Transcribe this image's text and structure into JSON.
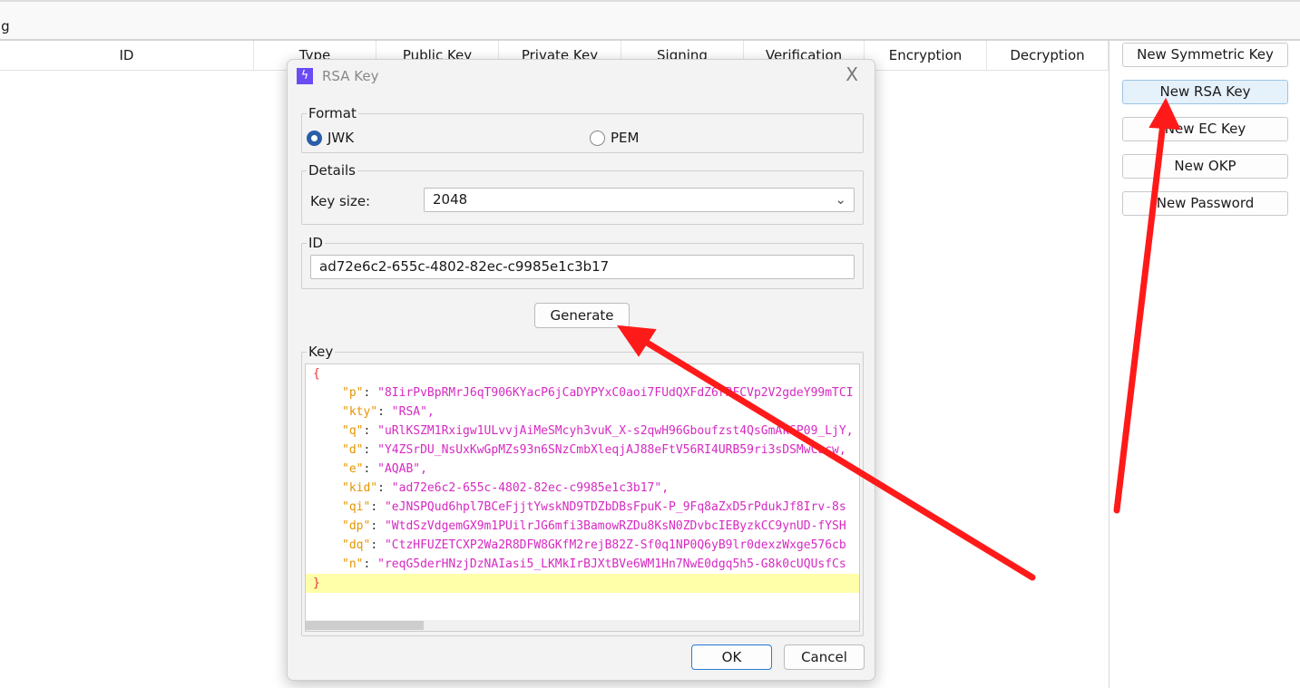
{
  "topbar": {
    "text": "ig"
  },
  "table": {
    "columns": [
      "ID",
      "Type",
      "Public Key",
      "Private Key",
      "Signing",
      "Verification",
      "Encryption",
      "Decryption"
    ]
  },
  "side_buttons": [
    "New Symmetric Key",
    "New RSA Key",
    "New EC Key",
    "New OKP",
    "New Password"
  ],
  "dialog": {
    "title": "RSA Key",
    "logo_icon": "lightning-icon",
    "close": "X",
    "format": {
      "label": "Format",
      "options": [
        "JWK",
        "PEM"
      ],
      "selected": "JWK"
    },
    "details": {
      "label": "Details",
      "key_size_label": "Key size:",
      "key_size": "2048"
    },
    "id": {
      "label": "ID",
      "value": "ad72e6c2-655c-4802-82ec-c9985e1c3b17"
    },
    "generate": "Generate",
    "key": {
      "label": "Key",
      "open": "{",
      "close": "}",
      "entries": [
        {
          "k": "\"p\"",
          "v": "\"8IirPvBpRMrJ6qT906KYacP6jCaDYPYxC0aoi7FUdQXFdZ6rRFCVp2V2gdeY99mTCI"
        },
        {
          "k": "\"kty\"",
          "v": "\"RSA\","
        },
        {
          "k": "\"q\"",
          "v": "\"uRlKSZM1Rxigw1ULvvjAiMeSMcyh3vuK_X-s2qwH96Gboufzst4QsGmAkSP09_LjY,"
        },
        {
          "k": "\"d\"",
          "v": "\"Y4ZSrDU_NsUxKwGpMZs93n6SNzCmbXleqjAJ88eFtV56RI4URB59ri3sDSMwCacw,"
        },
        {
          "k": "\"e\"",
          "v": "\"AQAB\","
        },
        {
          "k": "\"kid\"",
          "v": "\"ad72e6c2-655c-4802-82ec-c9985e1c3b17\","
        },
        {
          "k": "\"qi\"",
          "v": "\"eJNSPQud6hpl7BCeFjjtYwskND9TDZbDBsFpuK-P_9Fq8aZxD5rPdukJf8Irv-8s"
        },
        {
          "k": "\"dp\"",
          "v": "\"WtdSzVdgemGX9m1PUilrJG6mfi3BamowRZDu8KsN0ZDvbcIEByzkCC9ynUD-fYSH"
        },
        {
          "k": "\"dq\"",
          "v": "\"CtzHFUZETCXP2Wa2R8DFW8GKfM2rejB82Z-Sf0q1NP0Q6yB9lr0dexzWxge576cb"
        },
        {
          "k": "\"n\"",
          "v": "\"reqG5derHNzjDzNAIasi5_LKMkIrBJXtBVe6WM1Hn7NwE0dgq5h5-G8k0cUQUsfCs"
        }
      ]
    },
    "ok": "OK",
    "cancel": "Cancel"
  },
  "colors": {
    "annotation": "#ff1a1a",
    "json_key": "#e69500",
    "json_string": "#d62ac2",
    "accent": "#2a5ea8"
  }
}
